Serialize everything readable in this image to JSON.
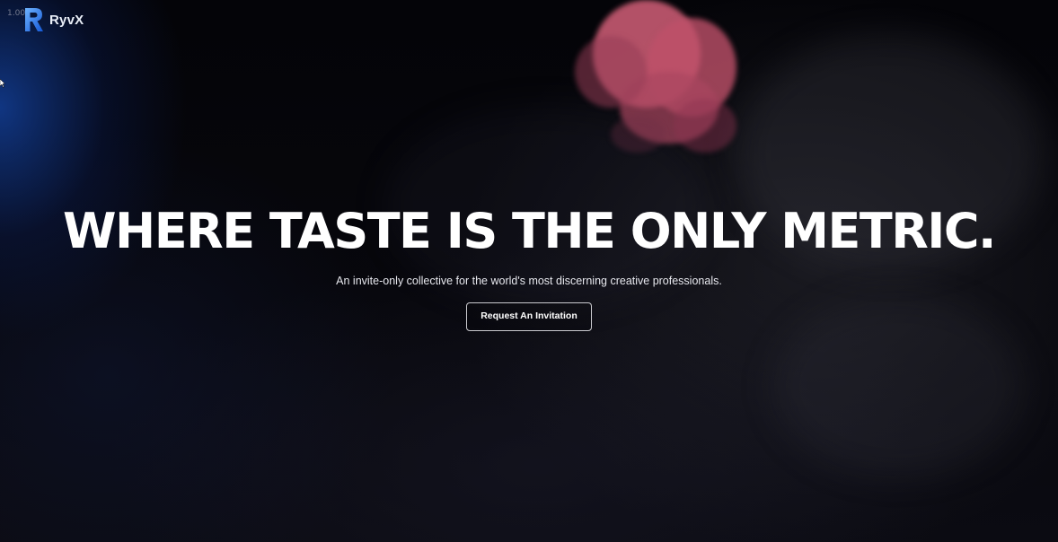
{
  "overlay": {
    "zoom_label": "1.00"
  },
  "brand": {
    "name": "RyvX",
    "logo_icon": "ryvx-r-logo-icon",
    "accent": "#1e7bff"
  },
  "hero": {
    "headline": "WHERE TASTE IS THE ONLY METRIC.",
    "subtitle": "An invite-only collective for the world's most discerning creative professionals.",
    "cta_label": "Request An Invitation"
  },
  "theme": {
    "background": "#05060a",
    "text": "#ffffff",
    "ink_color": "#d25f78"
  }
}
